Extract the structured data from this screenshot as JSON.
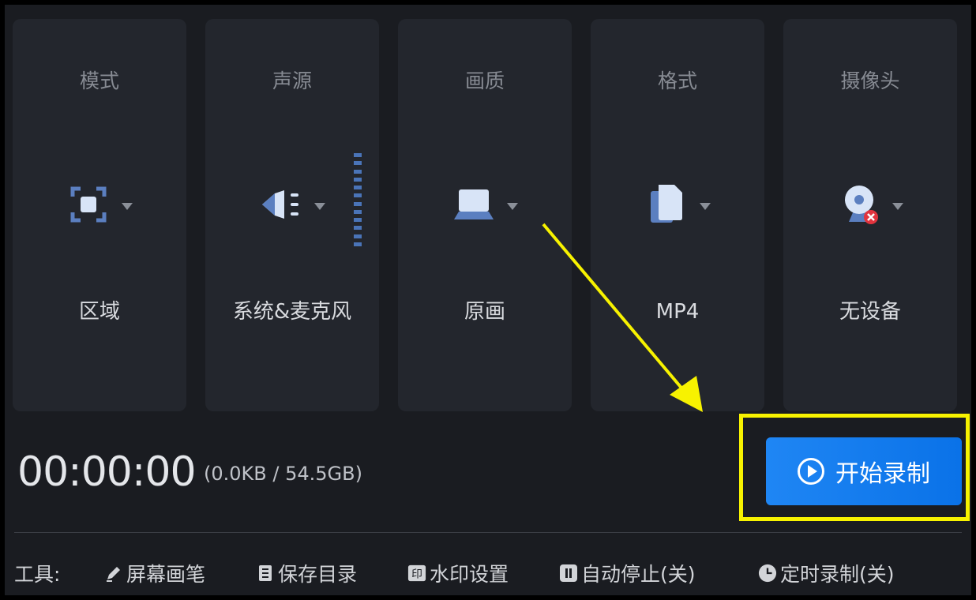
{
  "cards": [
    {
      "title": "模式",
      "value": "区域",
      "icon": "region-select-icon"
    },
    {
      "title": "声源",
      "value": "系统&麦克风",
      "icon": "speaker-icon"
    },
    {
      "title": "画质",
      "value": "原画",
      "icon": "laptop-icon"
    },
    {
      "title": "格式",
      "value": "MP4",
      "icon": "file-icon"
    },
    {
      "title": "摄像头",
      "value": "无设备",
      "icon": "webcam-off-icon"
    }
  ],
  "status": {
    "timer": "00:00:00",
    "storage": "(0.0KB / 54.5GB)"
  },
  "start_button": {
    "label": "开始录制",
    "icon": "play-circle-icon"
  },
  "toolbar": {
    "label": "工具:",
    "items": [
      {
        "label": "屏幕画笔",
        "icon": "pen-icon"
      },
      {
        "label": "保存目录",
        "icon": "folder-list-icon"
      },
      {
        "label": "水印设置",
        "icon": "watermark-icon"
      },
      {
        "label": "自动停止(关)",
        "icon": "pause-icon"
      },
      {
        "label": "定时录制(关)",
        "icon": "clock-icon"
      }
    ]
  },
  "colors": {
    "accent": "#1f86f4",
    "highlight": "#f7f200",
    "icon": "#c9d7ee"
  }
}
